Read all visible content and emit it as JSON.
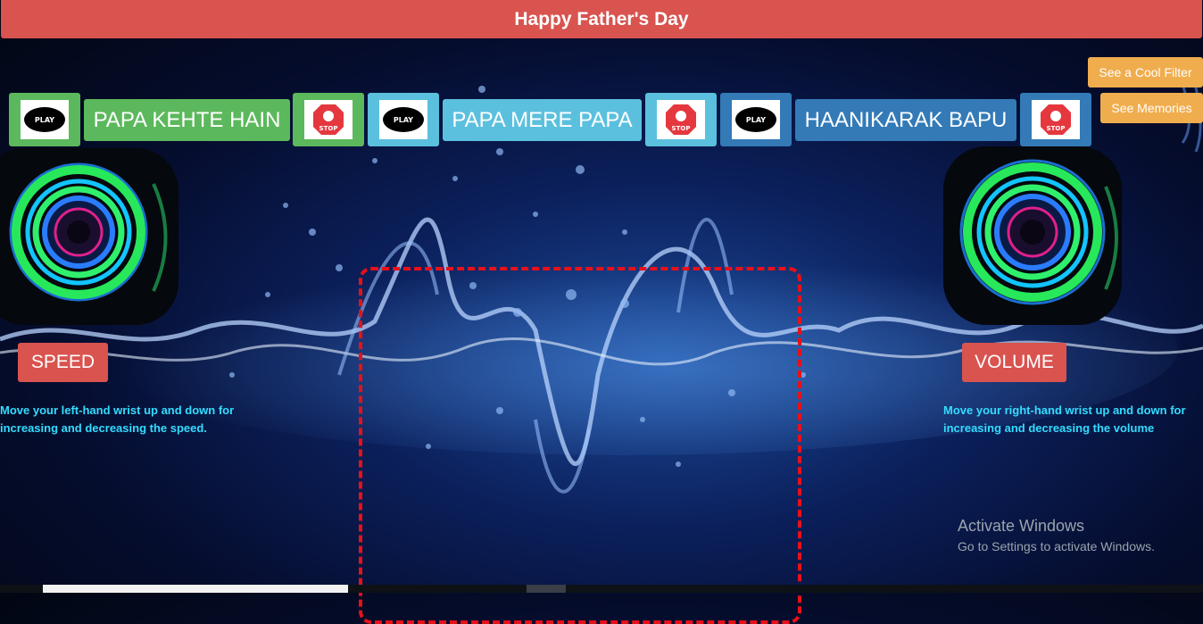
{
  "header": {
    "title": "Happy Father's Day"
  },
  "songs": [
    {
      "title": "PAPA KEHTE HAIN",
      "play_label": "PLAY",
      "stop_label": "STOP"
    },
    {
      "title": "PAPA MERE PAPA",
      "play_label": "PLAY",
      "stop_label": "STOP"
    },
    {
      "title": "HAANIKARAK BAPU",
      "play_label": "PLAY",
      "stop_label": "STOP"
    }
  ],
  "actions": {
    "filter_label": "See a Cool Filter",
    "memories_label": "See Memories"
  },
  "left_panel": {
    "button_label": "SPEED",
    "instruction_line1": "Move your left-hand wrist up and down for",
    "instruction_line2": "increasing and decreasing the speed."
  },
  "right_panel": {
    "button_label": "VOLUME",
    "instruction_line1": "Move your right-hand wrist up and down for",
    "instruction_line2": "increasing and decreasing the volume"
  },
  "watermark": {
    "line1": "Activate Windows",
    "line2": "Go to Settings to activate Windows."
  },
  "colors": {
    "header": "#d9534f",
    "song1": "#5cb85c",
    "song2": "#5bc0de",
    "song3": "#337ab7",
    "accent_orange": "#f0ad4e",
    "instruction_text": "#33ddff",
    "camera_border": "#e8101a"
  },
  "icons": [
    "play-icon",
    "stop-icon",
    "speaker-icon"
  ]
}
